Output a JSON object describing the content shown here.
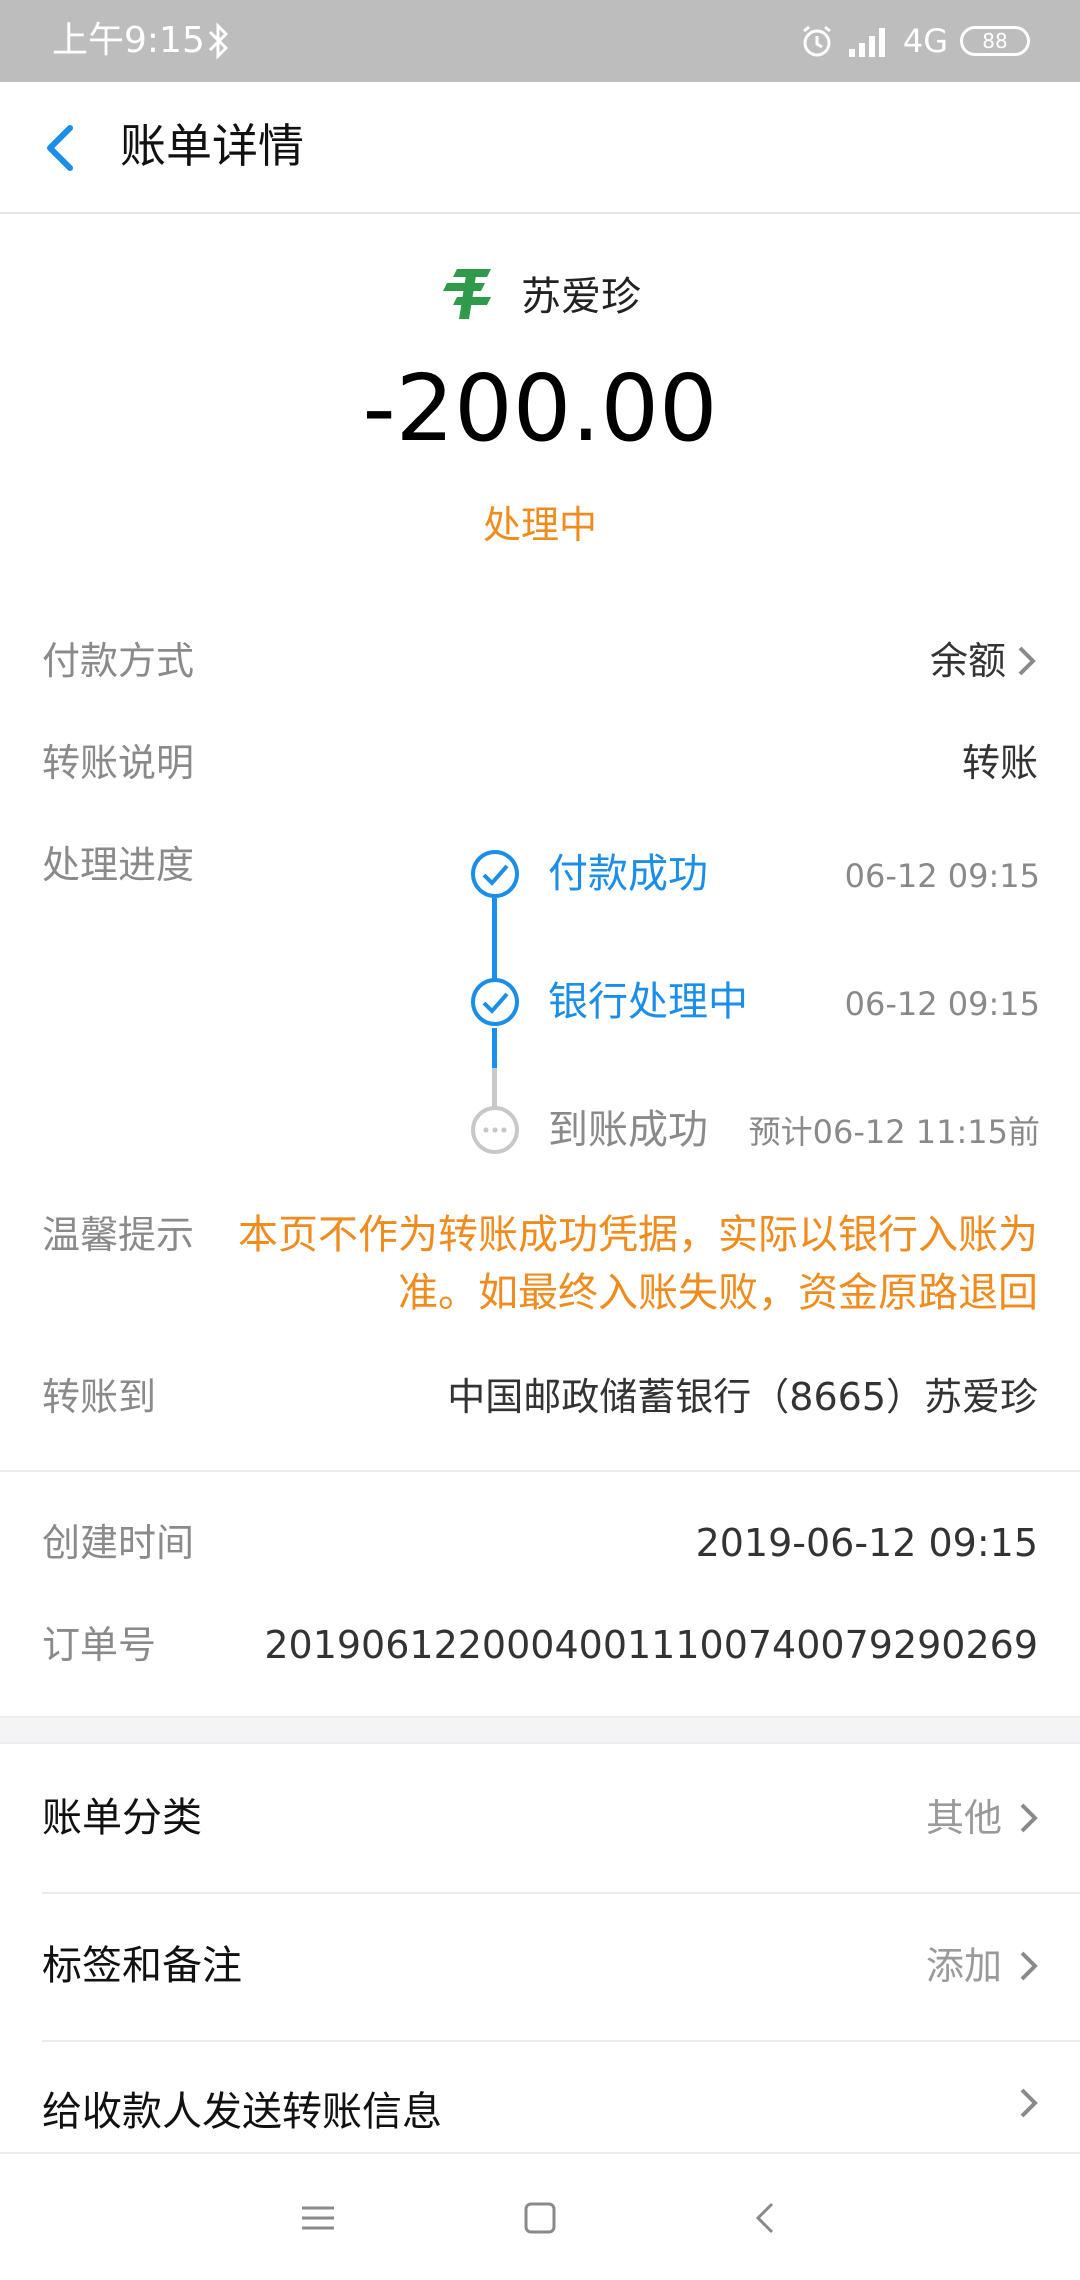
{
  "status_bar": {
    "time": "上午9:15",
    "network": "4G",
    "battery": "88"
  },
  "header": {
    "title": "账单详情"
  },
  "summary": {
    "payee_name": "苏爱珍",
    "amount": "-200.00",
    "status": "处理中"
  },
  "details": {
    "payment_method_label": "付款方式",
    "payment_method_value": "余额",
    "transfer_note_label": "转账说明",
    "transfer_note_value": "转账",
    "progress_label": "处理进度",
    "progress_steps": [
      {
        "label": "付款成功",
        "time": "06-12 09:15",
        "state": "done"
      },
      {
        "label": "银行处理中",
        "time": "06-12 09:15",
        "state": "done"
      },
      {
        "label": "到账成功",
        "time": "预计06-12 11:15前",
        "state": "pending"
      }
    ],
    "tip_label": "温馨提示",
    "tip_text": "本页不作为转账成功凭据，实际以银行入账为准。如最终入账失败，资金原路退回",
    "transfer_to_label": "转账到",
    "transfer_to_value": "中国邮政储蓄银行（8665）苏爱珍",
    "created_label": "创建时间",
    "created_value": "2019-06-12 09:15",
    "order_label": "订单号",
    "order_value": "20190612200040011100740079290269"
  },
  "menu": {
    "category_label": "账单分类",
    "category_value": "其他",
    "tags_label": "标签和备注",
    "tags_value": "添加",
    "send_info_label": "给收款人发送转账信息"
  },
  "colors": {
    "accent_blue": "#1a8ee8",
    "warning_orange": "#f08c1e",
    "pending_gray": "#c8c8c8"
  },
  "icons": {
    "payee_logo": "china-post-logo",
    "back": "back-arrow-icon"
  }
}
